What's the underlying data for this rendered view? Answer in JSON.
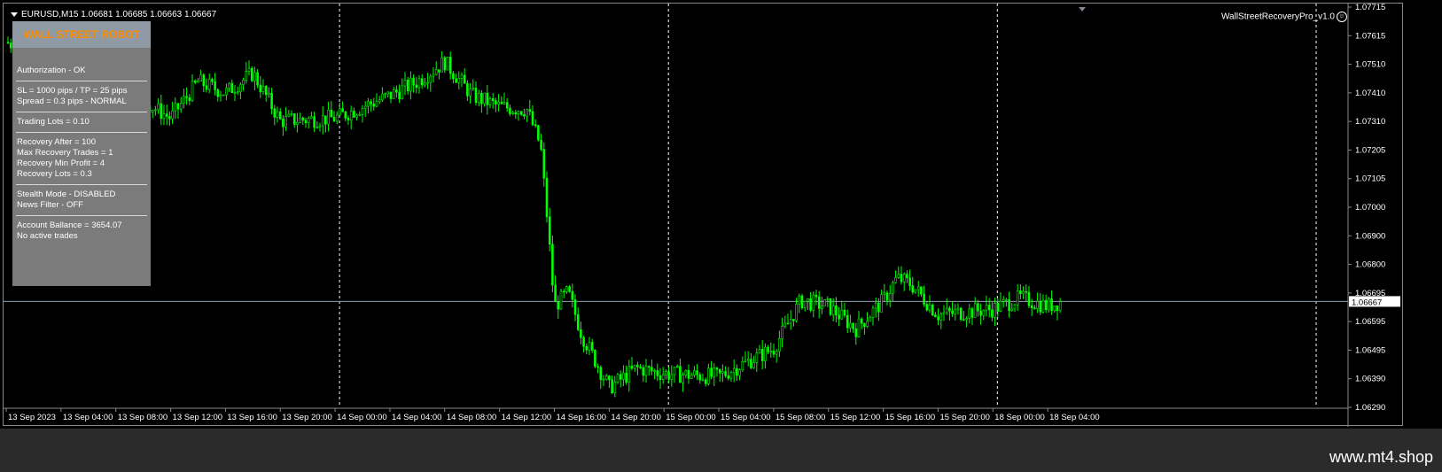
{
  "chart_header": {
    "symbol_line": "EURUSD,M15  1.06681 1.06685 1.06663 1.06667",
    "indicator_label": "WallStreetRecoveryPro_v1.0"
  },
  "panel": {
    "title": "WALL STREET ROBOT",
    "groups": [
      [
        "Authorization - OK"
      ],
      [
        "SL = 1000 pips / TP = 25 pips",
        "Spread = 0.3 pips - NORMAL"
      ],
      [
        "Trading Lots = 0.10"
      ],
      [
        "Recovery After = 100",
        "Max Recovery Trades = 1",
        "Recovery Min Profit = 4",
        "Recovery Lots = 0.3"
      ],
      [
        "Stealth Mode - DISABLED",
        "News Filter - OFF"
      ],
      [
        "Account Ballance = 3654.07",
        "No active trades"
      ]
    ]
  },
  "footer": {
    "site": "www.mt4.shop"
  },
  "colors": {
    "candle": "#00ff00",
    "grid": "#ffffff",
    "price_line": "#8fa0b0",
    "panel_bg": "#7b7b7b",
    "panel_title": "#ff8c00"
  },
  "chart_data": {
    "type": "candlestick",
    "symbol": "EURUSD",
    "timeframe": "M15",
    "current_price": "1.06667",
    "ylim": [
      1.0629,
      1.07715
    ],
    "y_ticks": [
      "1.07715",
      "1.07615",
      "1.07510",
      "1.07410",
      "1.07310",
      "1.07205",
      "1.07105",
      "1.07000",
      "1.06900",
      "1.06800",
      "1.06695",
      "1.06595",
      "1.06495",
      "1.06390",
      "1.06290"
    ],
    "x_ticks": [
      "13 Sep 2023",
      "13 Sep 04:00",
      "13 Sep 08:00",
      "13 Sep 12:00",
      "13 Sep 16:00",
      "13 Sep 20:00",
      "14 Sep 00:00",
      "14 Sep 04:00",
      "14 Sep 08:00",
      "14 Sep 12:00",
      "14 Sep 16:00",
      "14 Sep 20:00",
      "15 Sep 00:00",
      "15 Sep 04:00",
      "15 Sep 08:00",
      "15 Sep 12:00",
      "15 Sep 16:00",
      "15 Sep 20:00",
      "18 Sep 00:00",
      "18 Sep 04:00"
    ],
    "series": [
      {
        "name": "EURUSD",
        "approx_close_path": [
          [
            "13 Sep 00:00",
            1.0759
          ],
          [
            "13 Sep 04:00",
            1.0753
          ],
          [
            "13 Sep 08:00",
            1.0743
          ],
          [
            "13 Sep 10:00",
            1.0738
          ],
          [
            "13 Sep 12:00",
            1.0732
          ],
          [
            "13 Sep 14:00",
            1.0745
          ],
          [
            "13 Sep 16:00",
            1.0741
          ],
          [
            "13 Sep 18:00",
            1.0748
          ],
          [
            "13 Sep 20:00",
            1.0731
          ],
          [
            "14 Sep 00:00",
            1.0732
          ],
          [
            "14 Sep 04:00",
            1.074
          ],
          [
            "14 Sep 06:00",
            1.0745
          ],
          [
            "14 Sep 08:00",
            1.0752
          ],
          [
            "14 Sep 10:00",
            1.074
          ],
          [
            "14 Sep 12:00",
            1.0736
          ],
          [
            "14 Sep 14:00",
            1.0735
          ],
          [
            "14 Sep 15:00",
            1.0722
          ],
          [
            "14 Sep 15:30",
            1.0695
          ],
          [
            "14 Sep 16:00",
            1.0665
          ],
          [
            "14 Sep 17:00",
            1.067
          ],
          [
            "14 Sep 18:00",
            1.0655
          ],
          [
            "14 Sep 20:00",
            1.0636
          ],
          [
            "14 Sep 22:00",
            1.0643
          ],
          [
            "15 Sep 00:00",
            1.0641
          ],
          [
            "15 Sep 04:00",
            1.064
          ],
          [
            "15 Sep 06:00",
            1.0645
          ],
          [
            "15 Sep 08:00",
            1.065
          ],
          [
            "15 Sep 10:00",
            1.0667
          ],
          [
            "15 Sep 12:00",
            1.0665
          ],
          [
            "15 Sep 14:00",
            1.0657
          ],
          [
            "15 Sep 16:00",
            1.0667
          ],
          [
            "15 Sep 17:00",
            1.0675
          ],
          [
            "15 Sep 18:00",
            1.0673
          ],
          [
            "15 Sep 20:00",
            1.0662
          ],
          [
            "18 Sep 00:00",
            1.0664
          ],
          [
            "18 Sep 02:00",
            1.0668
          ],
          [
            "18 Sep 04:00",
            1.0665
          ],
          [
            "18 Sep 05:00",
            1.06667
          ]
        ]
      }
    ]
  }
}
